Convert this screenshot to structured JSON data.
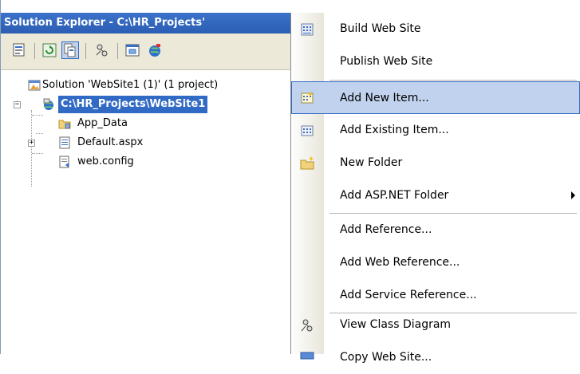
{
  "explorer": {
    "title": "Solution Explorer - C:\\HR_Projects'",
    "toolbar": {
      "buttons": [
        {
          "name": "properties-icon"
        },
        {
          "name": "refresh-icon"
        },
        {
          "name": "show-all-files-icon"
        },
        {
          "name": "view-class-diagram-icon"
        },
        {
          "name": "view-designer-icon"
        },
        {
          "name": "web-config-icon"
        }
      ]
    },
    "tree": {
      "solution": "Solution 'WebSite1 (1)' (1 project)",
      "project": "C:\\HR_Projects\\WebSite1",
      "items": [
        {
          "label": "App_Data",
          "icon": "folder-icon"
        },
        {
          "label": "Default.aspx",
          "icon": "aspx-page-icon"
        },
        {
          "label": "web.config",
          "icon": "config-file-icon"
        }
      ]
    }
  },
  "menu": {
    "items": [
      {
        "label": "Build Web Site",
        "icon": "build-icon"
      },
      {
        "label": "Publish Web Site",
        "icon": ""
      },
      {
        "label": "Add New Item...",
        "icon": "add-new-item-icon",
        "hot": true
      },
      {
        "label": "Add Existing Item...",
        "icon": "add-existing-item-icon"
      },
      {
        "label": "New Folder",
        "icon": "new-folder-icon"
      },
      {
        "label": "Add ASP.NET Folder",
        "icon": "",
        "submenu": true
      },
      {
        "label": "Add Reference...",
        "icon": ""
      },
      {
        "label": "Add Web Reference...",
        "icon": ""
      },
      {
        "label": "Add Service Reference...",
        "icon": ""
      },
      {
        "label": "View Class Diagram",
        "icon": "class-diagram-icon"
      },
      {
        "label": "Copy Web Site...",
        "icon": "copy-web-site-icon"
      }
    ]
  },
  "colors": {
    "title_bar": "#2b5db3",
    "selection": "#316ac5",
    "menu_highlight": "#c1d2ee"
  }
}
